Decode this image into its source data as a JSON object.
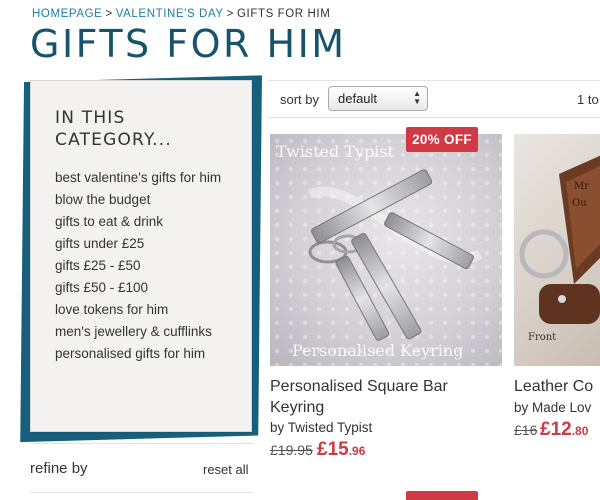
{
  "breadcrumb": {
    "home": "HOMEPAGE",
    "separator": ">",
    "valentines": "VALENTINE'S DAY",
    "current": "GIFTS FOR HIM"
  },
  "page_title": "GIFTS FOR HIM",
  "sidebar": {
    "heading_line1": "IN THIS",
    "heading_line2": "CATEGORY...",
    "items": [
      "best valentine's gifts for him",
      "blow the budget",
      "gifts to eat & drink",
      "gifts under £25",
      "gifts £25 - £50",
      "gifts £50 - £100",
      "love tokens for him",
      "men's jewellery & cufflinks",
      "personalised gifts for him"
    ],
    "accent_color": "#17607c"
  },
  "refine": {
    "label": "refine by",
    "reset": "reset all"
  },
  "sort": {
    "label": "sort by",
    "selected": "default",
    "pager_text": "1 to"
  },
  "products": [
    {
      "badge": "20% OFF",
      "watermark_top": "Twisted Typist",
      "watermark_bottom": "Personalised Keyring",
      "name_line1": "Personalised Square Bar",
      "name_line2": "Keyring",
      "by": "by Twisted Typist",
      "price_old": "£19.95",
      "price_new_main": "£15",
      "price_new_pence": ".96"
    },
    {
      "image_text": "Front",
      "name_line1": "Leather Co",
      "by": "by Made Lov",
      "price_old": "£16",
      "price_new_main": "£12",
      "price_new_pence": ".80"
    }
  ],
  "colors": {
    "title": "#17536b",
    "link": "#1f7fa0",
    "sale": "#cf3a45"
  }
}
